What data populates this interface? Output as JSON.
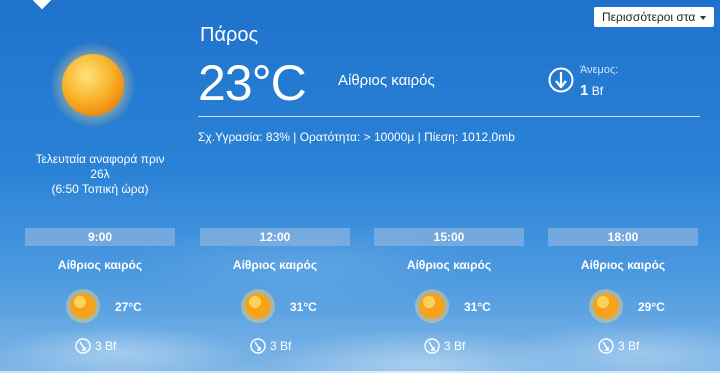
{
  "current": {
    "city": "Πάρος",
    "temperature": "23°C",
    "condition": "Αίθριος καιρός",
    "wind_label": "Άνεμος:",
    "wind_value": "1",
    "wind_unit": "Bf",
    "details": "Σχ.Υγρασία: 83% | Ορατότητα: > 10000μ | Πίεση: 1012,0mb",
    "report_line1": "Τελευταία αναφορά πριν",
    "report_line2": "26λ",
    "report_line3": "(6:50 Τοπική ώρα)"
  },
  "more_button": "Περισσότεροι στα",
  "forecast": [
    {
      "time": "9:00",
      "condition": "Αίθριος καιρός",
      "temperature": "27°C",
      "wind": "3 Bf"
    },
    {
      "time": "12:00",
      "condition": "Αίθριος καιρός",
      "temperature": "31°C",
      "wind": "3 Bf"
    },
    {
      "time": "15:00",
      "condition": "Αίθριος καιρός",
      "temperature": "31°C",
      "wind": "3 Bf"
    },
    {
      "time": "18:00",
      "condition": "Αίθριος καιρός",
      "temperature": "29°C",
      "wind": "3 Bf"
    }
  ],
  "icons": {
    "weather": "sun-icon",
    "wind": "wind-direction-icon"
  },
  "colors": {
    "sky_top": "#1f72cc",
    "sky_bottom": "#7fb6e6",
    "sun": "#f7a21b"
  }
}
